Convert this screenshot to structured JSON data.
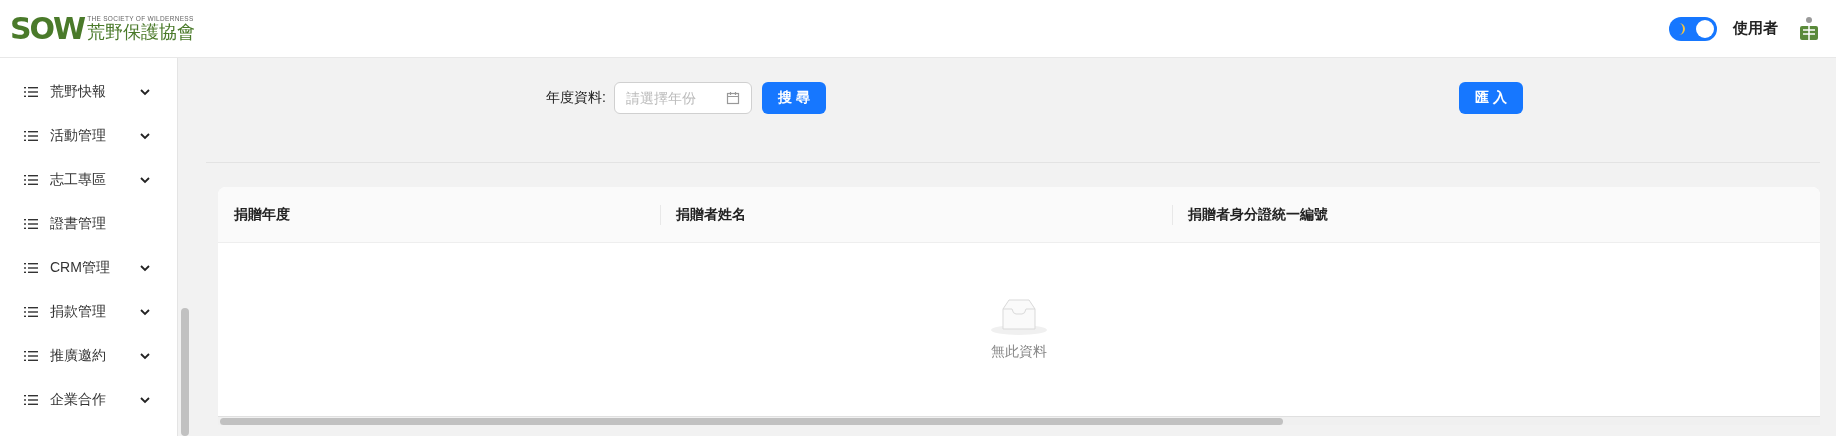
{
  "header": {
    "logo": {
      "mark": "SOW",
      "tagline": "THE SOCIETY OF WILDERNESS",
      "name": "荒野保護協會"
    },
    "theme_toggle": {
      "on": true
    },
    "user": "使用者"
  },
  "sidebar": {
    "items": [
      {
        "label": "荒野快報",
        "expandable": true
      },
      {
        "label": "活動管理",
        "expandable": true
      },
      {
        "label": "志工專區",
        "expandable": true
      },
      {
        "label": "證書管理",
        "expandable": false
      },
      {
        "label": "CRM管理",
        "expandable": true
      },
      {
        "label": "捐款管理",
        "expandable": true
      },
      {
        "label": "推廣邀約",
        "expandable": true
      },
      {
        "label": "企業合作",
        "expandable": true
      }
    ]
  },
  "filter": {
    "label": "年度資料:",
    "year_field": {
      "placeholder": "請選擇年份"
    },
    "search_button": "搜 尋",
    "import_button": "匯 入"
  },
  "table": {
    "columns": [
      "捐贈年度",
      "捐贈者姓名",
      "捐贈者身分證統一編號"
    ],
    "empty_text": "無此資料"
  }
}
